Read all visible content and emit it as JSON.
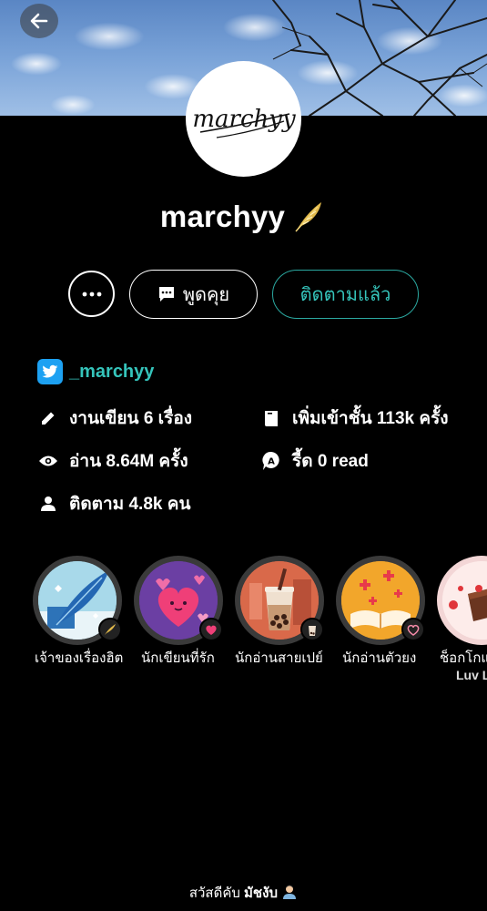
{
  "profile": {
    "username": "marchyy",
    "avatar_signature": "marchyy"
  },
  "actions": {
    "chat_label": "พูดคุย",
    "follow_label": "ติดตามแล้ว"
  },
  "twitter": {
    "handle": "_marchyy"
  },
  "stats": {
    "works": "งานเขียน 6 เรื่อง",
    "library_adds": "เพิ่มเข้าชั้น 113k ครั้ง",
    "reads": "อ่าน 8.64M ครั้ง",
    "read_points": "รี้ด 0 read",
    "followers": "ติดตาม 4.8k คน"
  },
  "badges": [
    {
      "label": "เจ้าของเรื่องฮิต",
      "label2": ""
    },
    {
      "label": "นักเขียนที่รัก",
      "label2": ""
    },
    {
      "label": "นักอ่านสายเปย์",
      "label2": ""
    },
    {
      "label": "นักอ่านตัวยง",
      "label2": ""
    },
    {
      "label": "ช็อกโกแ",
      "label2": "Luv L"
    }
  ],
  "footer": {
    "greeting": "สวัสดีคับ",
    "name": "มัชงับ"
  },
  "colors": {
    "accent": "#35c4bb",
    "twitter": "#1da1f2",
    "background": "#000000"
  }
}
